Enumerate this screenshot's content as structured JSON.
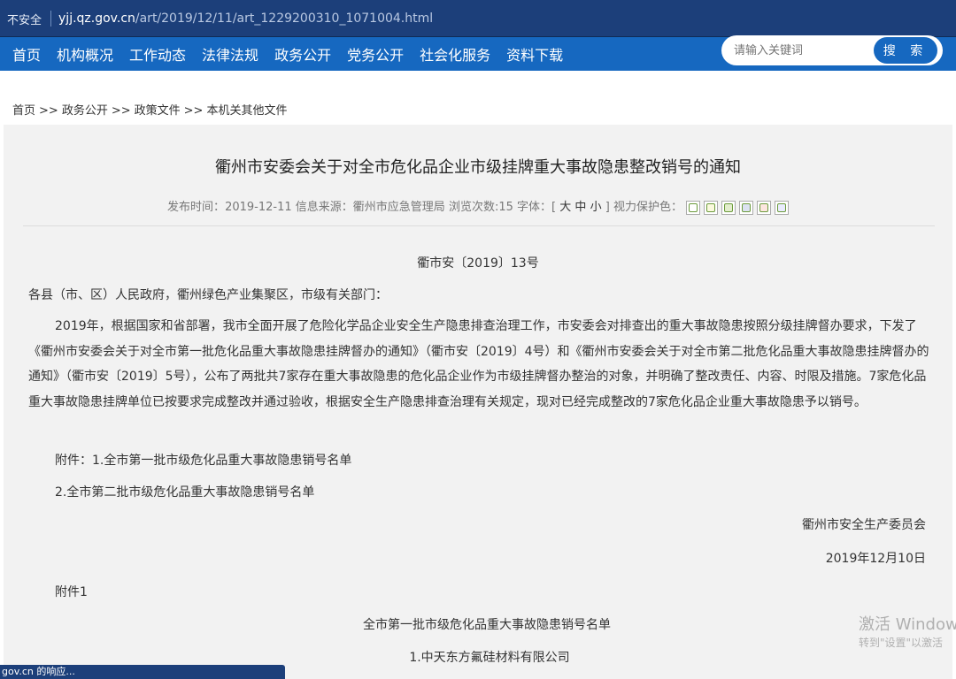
{
  "browser": {
    "security_label": "不安全",
    "url_host": "yjj.qz.gov.cn",
    "url_path": "/art/2019/12/11/art_1229200310_1071004.html",
    "status_text": "gov.cn 的响应..."
  },
  "nav": {
    "items": [
      "首页",
      "机构概况",
      "工作动态",
      "法律法规",
      "政务公开",
      "党务公开",
      "社会化服务",
      "资料下载"
    ]
  },
  "search": {
    "placeholder": "请输入关键词",
    "button_label": "搜 索"
  },
  "breadcrumb": {
    "items": [
      "首页",
      "政务公开",
      "政策文件",
      "本机关其他文件"
    ],
    "separator": ">>"
  },
  "article": {
    "title": "衢州市安委会关于对全市危化品企业市级挂牌重大事故隐患整改销号的通知",
    "meta": {
      "publish_label": "发布时间：",
      "publish_date": "2019-12-11",
      "source_label": "信息来源：",
      "source": "衢州市应急管理局",
      "views_label": "浏览次数:",
      "views": "15",
      "font_label": "字体：",
      "font_open": "[",
      "font_large": "大",
      "font_medium": "中",
      "font_small": "小",
      "font_close": "]",
      "eye_label": "视力保护色：",
      "eye_colors": [
        "#ffffff",
        "#faf9de",
        "#e3edcd",
        "#dce2f1",
        "#fde6e0",
        "#e9ebfe"
      ]
    },
    "doc_number": "衢市安〔2019〕13号",
    "addressee": "各县（市、区）人民政府，衢州绿色产业集聚区，市级有关部门：",
    "body": "2019年，根据国家和省部署，我市全面开展了危险化学品企业安全生产隐患排查治理工作，市安委会对排查出的重大事故隐患按照分级挂牌督办要求，下发了《衢州市安委会关于对全市第一批危化品重大事故隐患挂牌督办的通知》（衢市安〔2019〕4号）和《衢州市安委会关于对全市第二批危化品重大事故隐患挂牌督办的通知》（衢市安〔2019〕5号），公布了两批共7家存在重大事故隐患的危化品企业作为市级挂牌督办整治的对象，并明确了整改责任、内容、时限及措施。7家危化品重大事故隐患挂牌单位已按要求完成整改并通过验收，根据安全生产隐患排查治理有关规定，现对已经完成整改的7家危化品企业重大事故隐患予以销号。",
    "attachment_1": "附件：1.全市第一批市级危化品重大事故隐患销号名单",
    "attachment_2": "2.全市第二批市级危化品重大事故隐患销号名单",
    "signature": "衢州市安全生产委员会",
    "date": "2019年12月10日",
    "appendix_label": "附件1",
    "list_title": "全市第一批市级危化品重大事故隐患销号名单",
    "list_items": [
      "1.中天东方氟硅材料有限公司"
    ]
  },
  "watermark": {
    "line1": "激活 Window",
    "line2": "转到\"设置\"以激活"
  }
}
